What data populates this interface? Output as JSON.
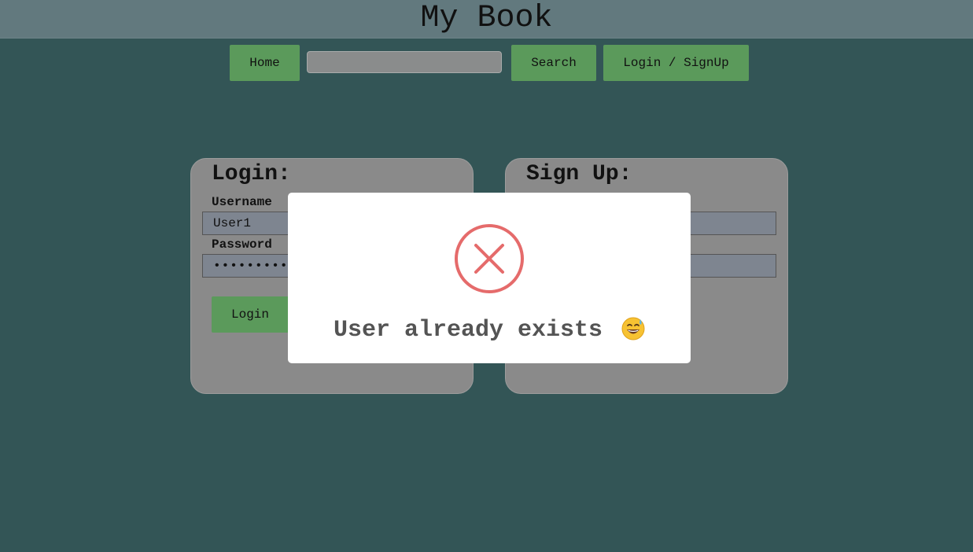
{
  "app": {
    "title": "My Book"
  },
  "nav": {
    "home_label": "Home",
    "search_value": "",
    "search_label": "Search",
    "login_signup_label": "Login / SignUp"
  },
  "login": {
    "title": "Login:",
    "username_label": "Username",
    "username_value": "User1",
    "password_label": "Password",
    "password_value": "••••••••••••",
    "button_label": "Login"
  },
  "signup": {
    "title": "Sign Up:"
  },
  "modal": {
    "message": "User already exists",
    "icon": "error-x-icon",
    "emoji": "grinning-sweat-emoji"
  },
  "colors": {
    "background": "#335556",
    "header": "#62797e",
    "button": "#5b9a5b",
    "panel": "#8a8a8a",
    "error": "#e56b6b"
  }
}
